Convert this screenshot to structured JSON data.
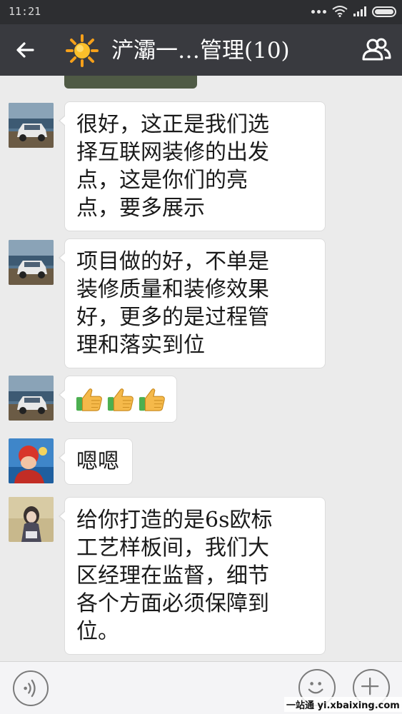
{
  "status_bar": {
    "time": "11:21",
    "icons": [
      "more-dots-icon",
      "wifi-icon",
      "signal-icon",
      "battery-icon"
    ]
  },
  "header": {
    "back_icon": "back-arrow-icon",
    "group_icon": "sun-emoji-icon",
    "title": "浐灞一…管理(10)",
    "members_icon": "group-members-icon"
  },
  "messages": [
    {
      "avatar": "avatar-car",
      "text": "很好，这正是我们选\n择互联网装修的出发\n点，这是你们的亮\n点，要多展示"
    },
    {
      "avatar": "avatar-car",
      "text": "项目做的好，不单是\n装修质量和装修效果\n好，更多的是过程管\n理和落实到位"
    },
    {
      "avatar": "avatar-car",
      "emoji": [
        "thumbs-up-icon",
        "thumbs-up-icon",
        "thumbs-up-icon"
      ]
    },
    {
      "avatar": "avatar-red-hat",
      "text": "嗯嗯"
    },
    {
      "avatar": "avatar-girl",
      "text": "给你打造的是6s欧标\n工艺样板间，我们大\n区经理在监督，细节\n各个方面必须保障到\n位。"
    }
  ],
  "input_bar": {
    "voice_icon": "voice-icon",
    "emoji_icon": "emoji-face-icon",
    "plus_icon": "plus-icon"
  },
  "watermark": "一站通 yi.xbaixing.com",
  "colors": {
    "status_bg": "#2d2e31",
    "header_bg": "#393a3f",
    "chat_bg": "#ebebeb",
    "bubble_bg": "#ffffff",
    "thumb_yellow": "#f5b94a",
    "cuff_green": "#4caf50"
  }
}
